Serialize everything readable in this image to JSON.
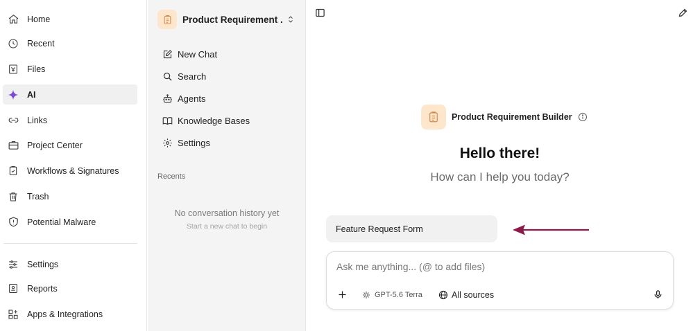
{
  "sidebar": {
    "items": [
      {
        "label": "Home",
        "icon": "home-icon"
      },
      {
        "label": "Recent",
        "icon": "clock-icon"
      },
      {
        "label": "Files",
        "icon": "files-icon"
      },
      {
        "label": "AI",
        "icon": "sparkle-icon",
        "active": true
      },
      {
        "label": "Links",
        "icon": "link-icon"
      },
      {
        "label": "Project Center",
        "icon": "briefcase-icon"
      },
      {
        "label": "Workflows & Signatures",
        "icon": "clipboard-check-icon"
      },
      {
        "label": "Trash",
        "icon": "trash-icon"
      },
      {
        "label": "Potential Malware",
        "icon": "shield-alert-icon"
      }
    ],
    "bottom_items": [
      {
        "label": "Settings",
        "icon": "sliders-icon"
      },
      {
        "label": "Reports",
        "icon": "report-icon"
      },
      {
        "label": "Apps & Integrations",
        "icon": "apps-icon"
      }
    ],
    "accent_color": "#7b4bd6"
  },
  "panel": {
    "workspace_title": "Product Requirement ...",
    "menu": [
      {
        "label": "New Chat",
        "icon": "new-chat-icon"
      },
      {
        "label": "Search",
        "icon": "search-icon"
      },
      {
        "label": "Agents",
        "icon": "robot-icon"
      },
      {
        "label": "Knowledge Bases",
        "icon": "book-icon"
      },
      {
        "label": "Settings",
        "icon": "gear-icon"
      }
    ],
    "recents_title": "Recents",
    "empty_title": "No conversation history yet",
    "empty_subtitle": "Start a new chat to begin"
  },
  "main": {
    "agent_name": "Product Requirement Builder",
    "greeting": "Hello there!",
    "help_text": "How can I help you today?",
    "suggestion": "Feature Request Form",
    "composer": {
      "placeholder": "Ask me anything... (@ to add files)",
      "model_label": "GPT-5.6 Terra",
      "sources_label": "All sources"
    },
    "arrow_color": "#8b1a4a",
    "avatar_bg": "#fde6cc"
  }
}
